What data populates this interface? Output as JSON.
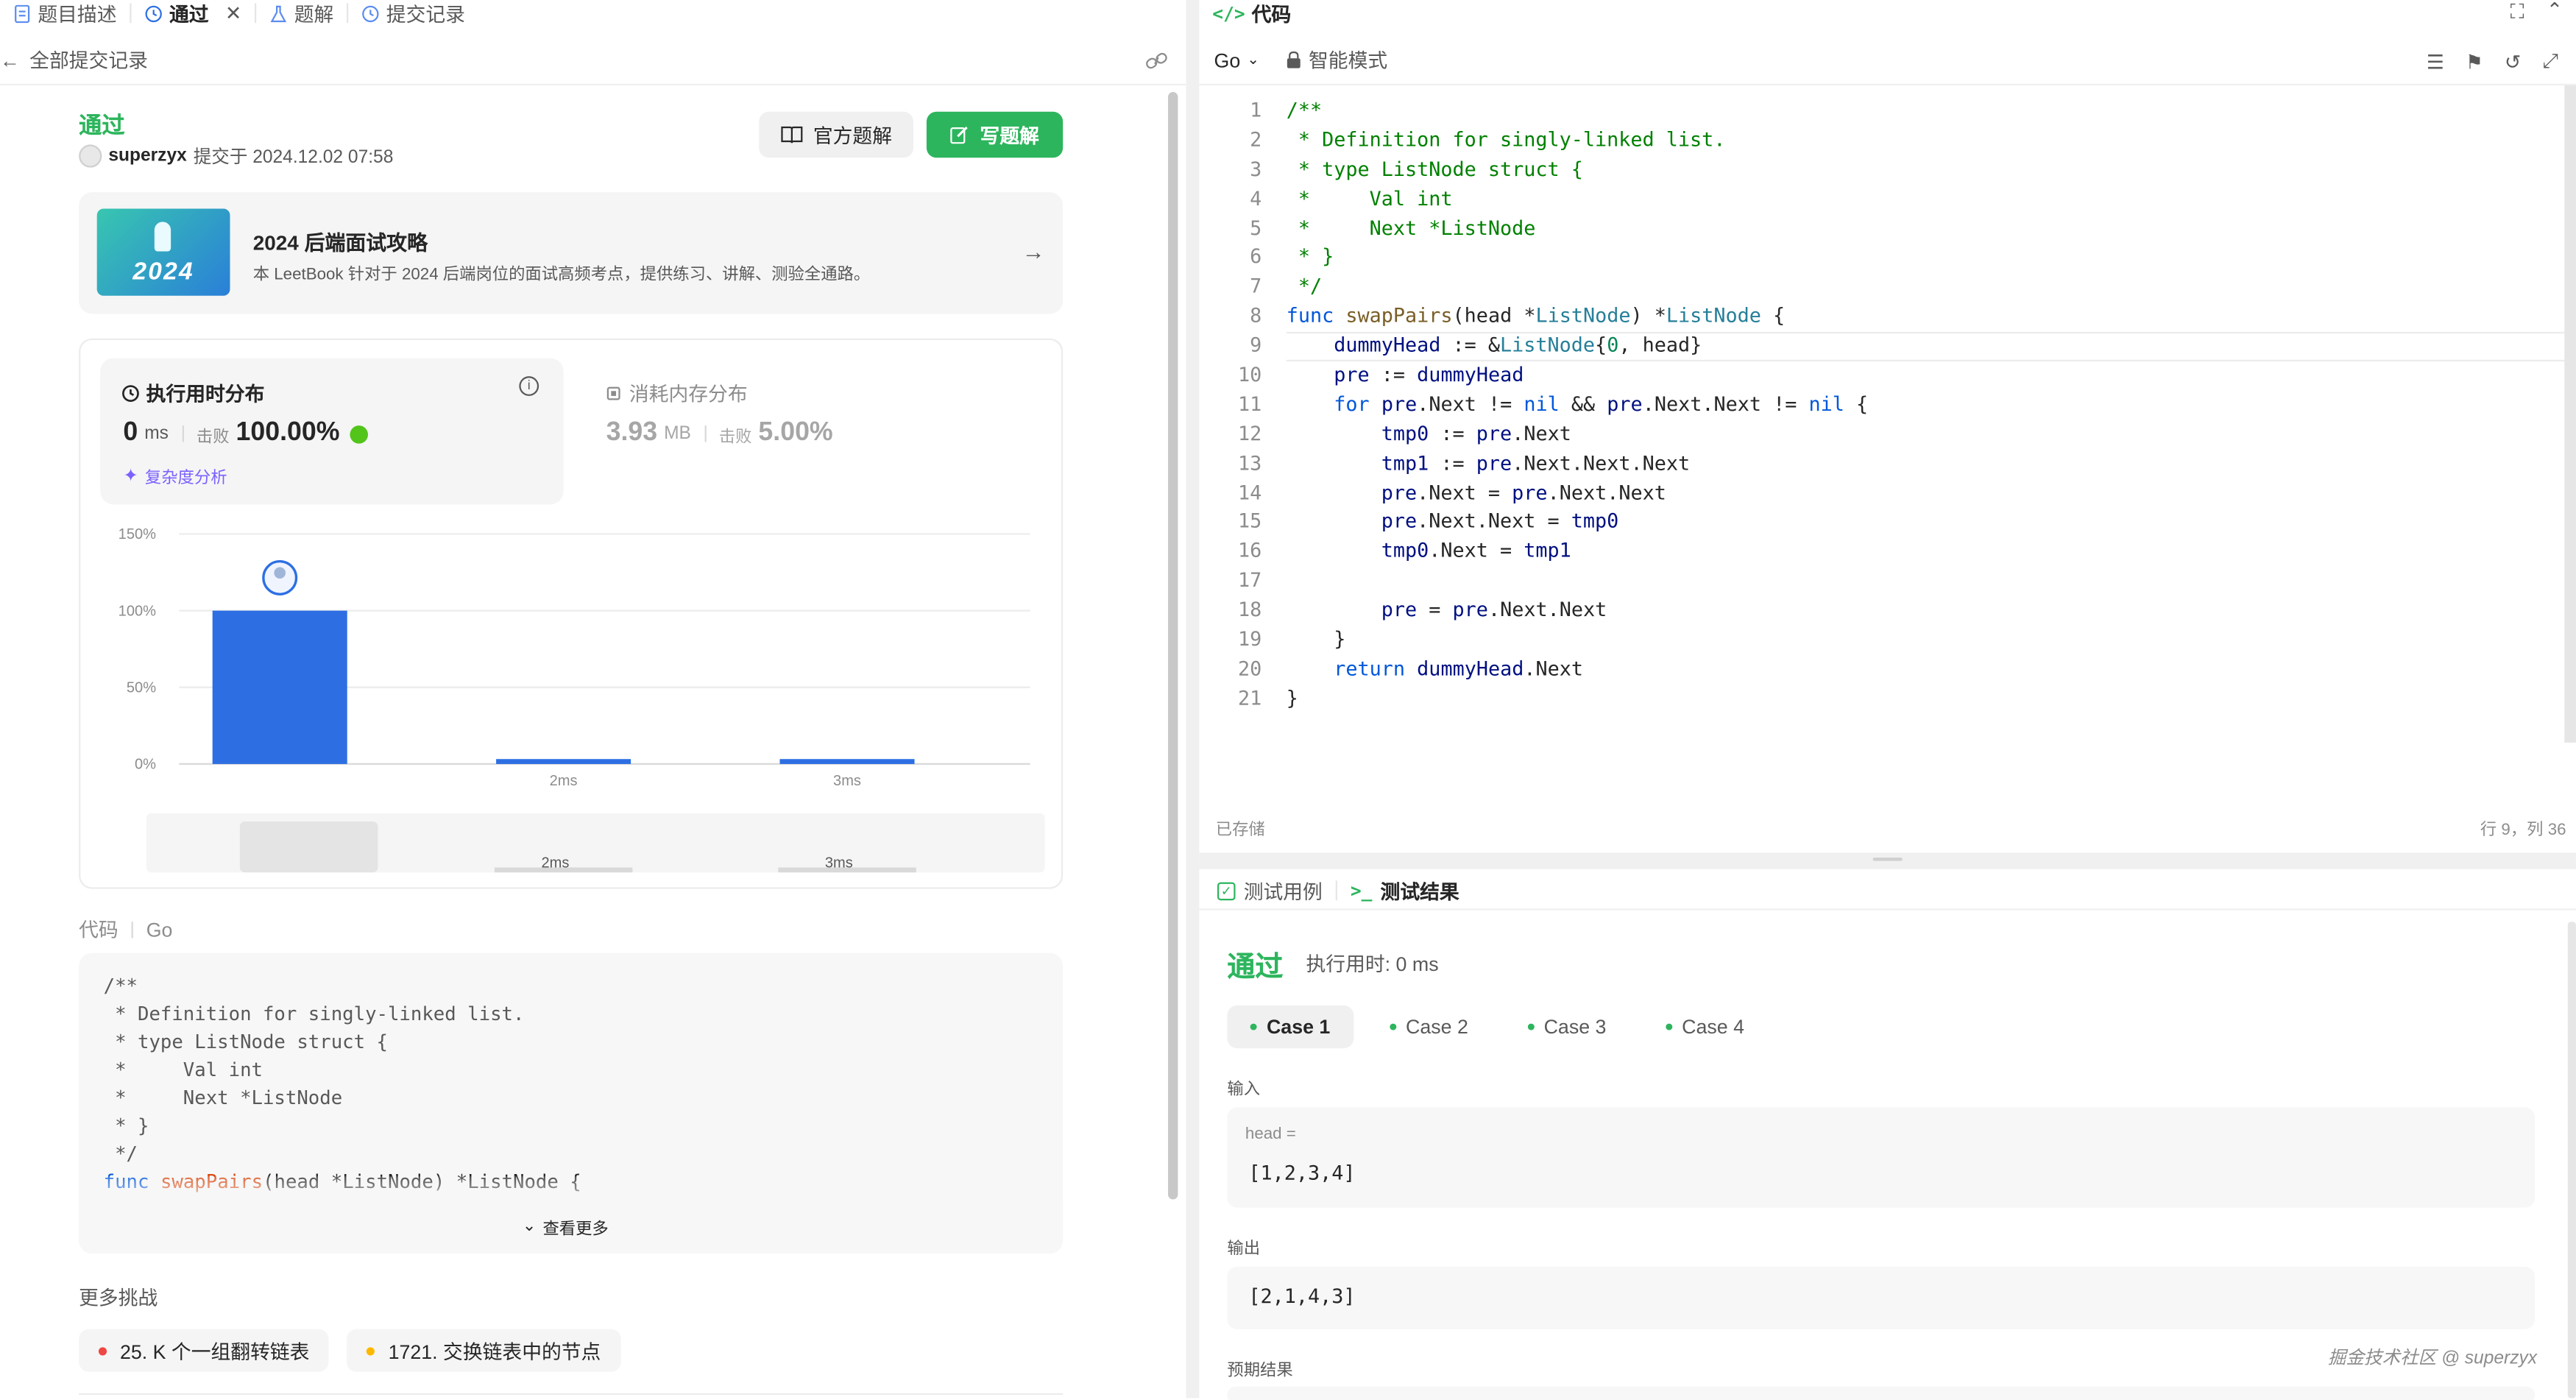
{
  "tabs": [
    {
      "label": "题目描述",
      "icon": "document-icon"
    },
    {
      "label": "通过",
      "icon": "history-icon",
      "active": true
    },
    {
      "label": "题解",
      "icon": "flask-icon"
    },
    {
      "label": "提交记录",
      "icon": "history-icon"
    }
  ],
  "left": {
    "back_label": "全部提交记录",
    "status": "通过",
    "user": "superzyx",
    "submitted_at": "提交于 2024.12.02 07:58",
    "official_solution_btn": "官方题解",
    "write_solution_btn": "写题解",
    "banner": {
      "badge": "2024",
      "title": "2024 后端面试攻略",
      "desc": "本 LeetBook 针对于 2024 后端岗位的面试高频考点，提供练习、讲解、测验全通路。"
    },
    "runtime": {
      "title": "执行用时分布",
      "value": "0",
      "unit": "ms",
      "beat_label": "击败",
      "beat": "100.00%",
      "analysis": "复杂度分析"
    },
    "memory": {
      "title": "消耗内存分布",
      "value": "3.93",
      "unit": "MB",
      "beat_label": "击败",
      "beat": "5.00%"
    },
    "code_label": "代码",
    "code_lang": "Go",
    "more_label": "查看更多",
    "more_challenges": "更多挑战",
    "challenges": [
      {
        "label": "25. K 个一组翻转链表",
        "color": "#ef4743"
      },
      {
        "label": "1721. 交换链表中的节点",
        "color": "#ffb800"
      }
    ]
  },
  "chart_data": {
    "type": "bar",
    "categories": [
      "0ms",
      "2ms",
      "3ms"
    ],
    "tick_labels": [
      "",
      "2ms",
      "3ms"
    ],
    "values": [
      100,
      1,
      1
    ],
    "y_ticks": [
      "150%",
      "100%",
      "50%",
      "0%"
    ],
    "ylim": [
      0,
      150
    ],
    "highlight_index": 0,
    "bar_color": "#2d6fe3",
    "nav_labels": [
      "2ms",
      "3ms"
    ]
  },
  "snippet": [
    "/**",
    " * Definition for singly-linked list.",
    " * type ListNode struct {",
    " *     Val int",
    " *     Next *ListNode",
    " * }",
    " */",
    "func swapPairs(head *ListNode) *ListNode {"
  ],
  "editor": {
    "title": "代码",
    "lang": "Go",
    "mode": "智能模式",
    "saved": "已存储",
    "cursor": "行 9，列 36",
    "lines": [
      "/**",
      " * Definition for singly-linked list.",
      " * type ListNode struct {",
      " *     Val int",
      " *     Next *ListNode",
      " * }",
      " */",
      "func swapPairs(head *ListNode) *ListNode {",
      "    dummyHead := &ListNode{0, head}",
      "    pre := dummyHead",
      "    for pre.Next != nil && pre.Next.Next != nil {",
      "        tmp0 := pre.Next",
      "        tmp1 := pre.Next.Next.Next",
      "        pre.Next = pre.Next.Next",
      "        pre.Next.Next = tmp0",
      "        tmp0.Next = tmp1",
      "",
      "        pre = pre.Next.Next",
      "    }",
      "    return dummyHead.Next",
      "}"
    ]
  },
  "result": {
    "tab_cases": "测试用例",
    "tab_result": "测试结果",
    "status": "通过",
    "runtime": "执行用时: 0 ms",
    "cases": [
      "Case 1",
      "Case 2",
      "Case 3",
      "Case 4"
    ],
    "input_label": "输入",
    "input_var": "head =",
    "input_value": "[1,2,3,4]",
    "output_label": "输出",
    "output_value": "[2,1,4,3]",
    "expected_label": "预期结果"
  },
  "watermark": "掘金技术社区 @ superzyx",
  "colors": {
    "green": "#2db55d",
    "blue": "#2d6fe3",
    "accent": "#007aff"
  }
}
